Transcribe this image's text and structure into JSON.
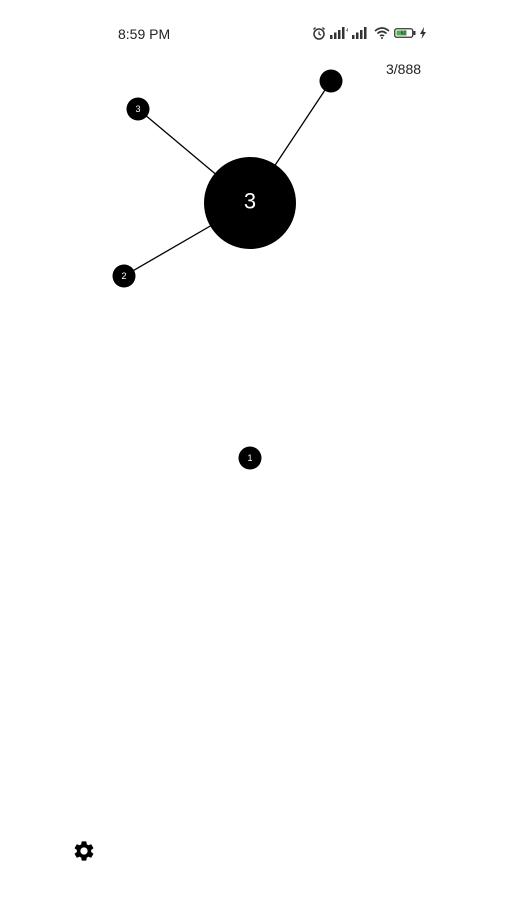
{
  "status_bar": {
    "time": "8:59 PM",
    "battery_level": "62",
    "icons": [
      "alarm-icon",
      "signal-icon",
      "signal-icon",
      "wifi-icon",
      "battery-icon",
      "charging-icon"
    ]
  },
  "level": {
    "counter": "3/888"
  },
  "game": {
    "core_count": "3",
    "stuck_pins": [
      {
        "label": "3"
      },
      {
        "label": ""
      },
      {
        "label": "2"
      }
    ],
    "next_pin": {
      "label": "1"
    }
  },
  "controls": {
    "settings_icon": "gear-icon"
  },
  "colors": {
    "background": "#ffffff",
    "foreground": "#000000",
    "battery_fill": "#4caf50"
  }
}
